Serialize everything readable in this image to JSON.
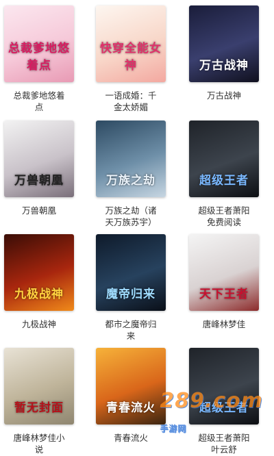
{
  "books": [
    {
      "cover_text": "总裁爹地悠着点",
      "caption": "总裁爹地悠着\n点",
      "cover_colors": [
        "#fbe7ef",
        "#f6c9d9",
        "#e89ab4"
      ],
      "text_color": "#d81b60"
    },
    {
      "cover_text": "快穿全能女神",
      "caption": "一语成婚：千\n金太娇媚",
      "cover_colors": [
        "#fdf6f0",
        "#f8d7c9",
        "#f3a8a0"
      ],
      "text_color": "#e0306a"
    },
    {
      "cover_text": "万古战神",
      "caption": "万古战神",
      "cover_colors": [
        "#1a1d3a",
        "#3a3f6e",
        "#10101e"
      ],
      "text_color": "#ffffff"
    },
    {
      "cover_text": "万兽朝凰",
      "caption": "万兽朝凰",
      "cover_colors": [
        "#f2f2f2",
        "#c9c2c9",
        "#7a6f7a"
      ],
      "text_color": "#222222"
    },
    {
      "cover_text": "万族之劫",
      "caption": "万族之劫（诸\n天万族苏宇）",
      "cover_colors": [
        "#2d4a62",
        "#6e8fa8",
        "#c7d6e2"
      ],
      "text_color": "#e9f1f8"
    },
    {
      "cover_text": "超级王者",
      "caption": "超级王者萧阳\n免费阅读",
      "cover_colors": [
        "#1f2329",
        "#3d444d",
        "#0c0e12"
      ],
      "text_color": "#7ab8ff"
    },
    {
      "cover_text": "九极战神",
      "caption": "九极战神",
      "cover_colors": [
        "#3a0d06",
        "#a8260e",
        "#f08a1a"
      ],
      "text_color": "#ffd23f"
    },
    {
      "cover_text": "魔帝归来",
      "caption": "都市之魔帝归\n来",
      "cover_colors": [
        "#0e1a2a",
        "#27425e",
        "#0a0f18"
      ],
      "text_color": "#9fdcff"
    },
    {
      "cover_text": "天下王者",
      "caption": "唐峰林梦佳",
      "cover_colors": [
        "#f4f4f4",
        "#d9d2d2",
        "#8c2a2a"
      ],
      "text_color": "#c8102e"
    },
    {
      "cover_text": "暂无封面",
      "caption": "唐峰林梦佳小\n说",
      "cover_colors": [
        "#e8e2d5",
        "#bfb49a",
        "#8f8670"
      ],
      "text_color": "#b5121b"
    },
    {
      "cover_text": "青春流火",
      "caption": "青春流火",
      "cover_colors": [
        "#f6b23a",
        "#d9661a",
        "#3a2410"
      ],
      "text_color": "#ffffff"
    },
    {
      "cover_text": "超级王者",
      "caption": "超级王者萧阳\n叶云舒",
      "cover_colors": [
        "#1f2329",
        "#3d444d",
        "#0c0e12"
      ],
      "text_color": "#7ab8ff"
    }
  ],
  "watermark": {
    "text": "289.com",
    "sub": "手游网"
  }
}
